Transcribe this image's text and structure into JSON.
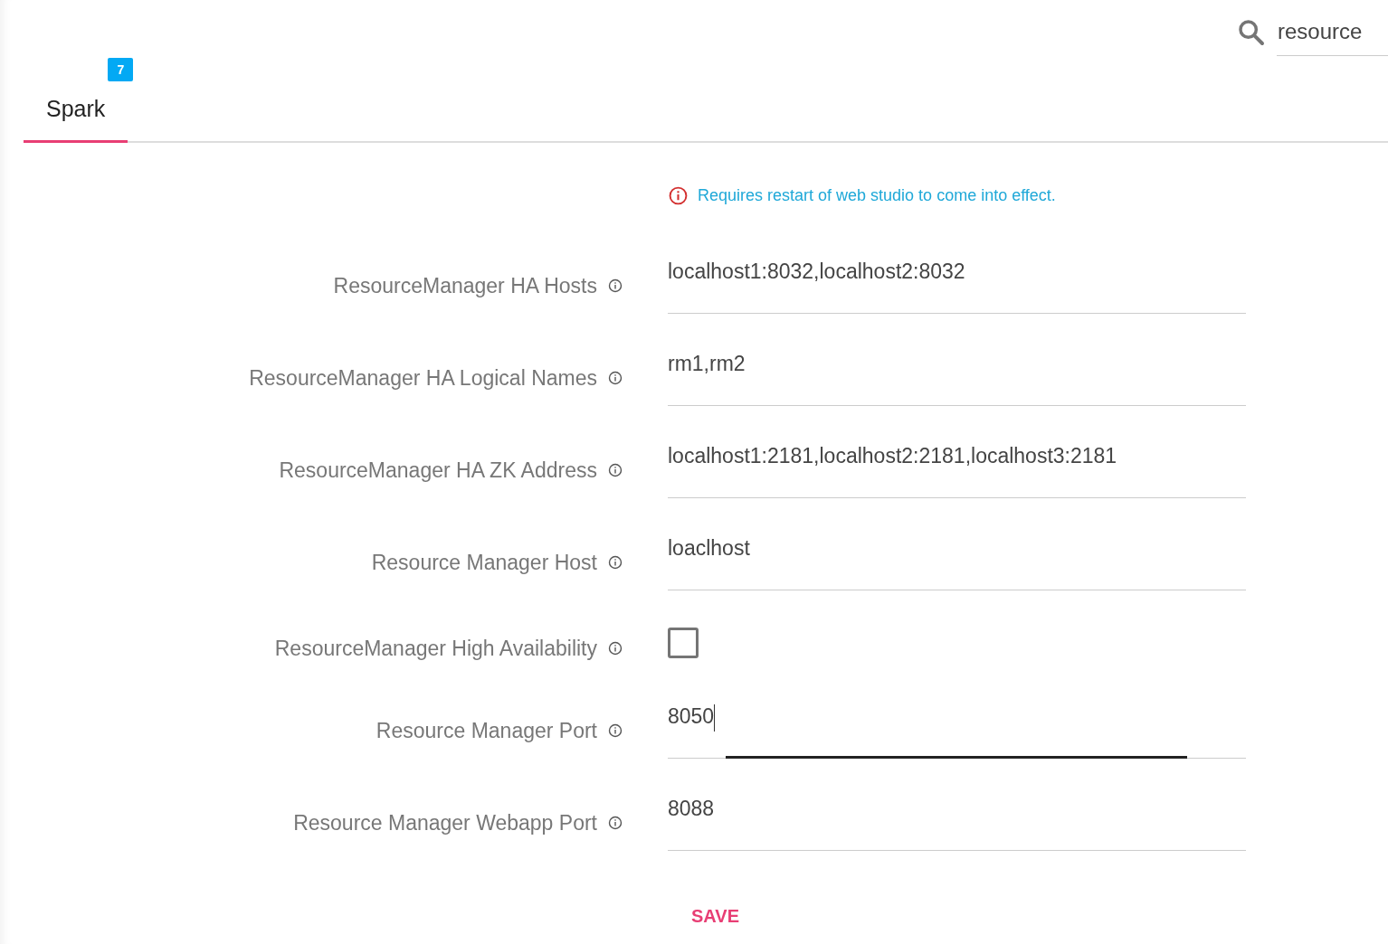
{
  "search": {
    "value": "resource"
  },
  "tabs": [
    {
      "label": "Spark",
      "badge": "7",
      "selected": true
    }
  ],
  "notice": "Requires restart of web studio to come into effect.",
  "fields": [
    {
      "kind": "text",
      "label": "ResourceManager HA Hosts",
      "value": "localhost1:8032,localhost2:8032",
      "focused": false
    },
    {
      "kind": "text",
      "label": "ResourceManager HA Logical Names",
      "value": "rm1,rm2",
      "focused": false
    },
    {
      "kind": "text",
      "label": "ResourceManager HA ZK Address",
      "value": "localhost1:2181,localhost2:2181,localhost3:2181",
      "focused": false
    },
    {
      "kind": "text",
      "label": "Resource Manager Host",
      "value": "loaclhost",
      "focused": false
    },
    {
      "kind": "checkbox",
      "label": "ResourceManager High Availability",
      "checked": false
    },
    {
      "kind": "text",
      "label": "Resource Manager Port",
      "value": "8050",
      "focused": true
    },
    {
      "kind": "text",
      "label": "Resource Manager Webapp Port",
      "value": "8088",
      "focused": false
    }
  ],
  "save": "SAVE"
}
